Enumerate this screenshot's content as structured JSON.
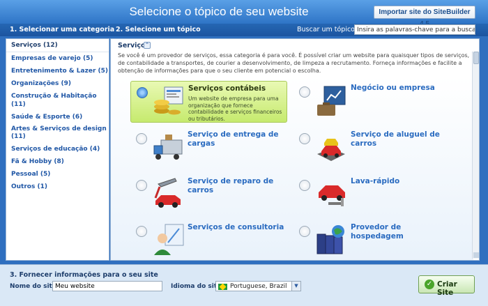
{
  "window": {
    "title": "Selecione o tópico de seu website",
    "import_button": "Importar site do SiteBuilder 4.5"
  },
  "steps": {
    "step1": "1. Selecionar uma categoria",
    "step2": "2. Selecione um tópico",
    "step3": "3. Fornecer informações para o seu site"
  },
  "search": {
    "label": "Buscar um tópico",
    "placeholder": "Insira as palavras-chave para a busca."
  },
  "categories": [
    {
      "label": "Serviços (12)",
      "selected": true
    },
    {
      "label": "Empresas de varejo (5)"
    },
    {
      "label": "Entretenimento & Lazer (5)"
    },
    {
      "label": "Organizações (9)"
    },
    {
      "label": "Construção & Habitação (11)"
    },
    {
      "label": "Saúde & Esporte (6)"
    },
    {
      "label": "Artes & Serviços de design (11)"
    },
    {
      "label": "Serviços de educação (4)"
    },
    {
      "label": "Fã & Hobby (8)"
    },
    {
      "label": "Pessoal (5)"
    },
    {
      "label": "Outros (1)"
    }
  ],
  "section": {
    "title": "Serviços",
    "description": "Se você é um provedor de serviços, essa categoria é para você. É possível criar um website para quaisquer tipos de serviços, de contabilidade a transportes, de courier a desenvolvimento, de limpeza a recrutamento. Forneça informações e facilite a obtenção de informações para que o seu cliente em potencial o escolha."
  },
  "topics": [
    {
      "label": "Serviços contábeis",
      "description": "Um website de empresa para uma organização que fornece contabilidade e serviços financeiros ou tributários.",
      "selected": true,
      "icon": "accounting-icon"
    },
    {
      "label": "Negócio ou empresa",
      "icon": "business-icon"
    },
    {
      "label": "Serviço de entrega de cargas",
      "icon": "delivery-truck-icon"
    },
    {
      "label": "Serviço de aluguel de carros",
      "icon": "car-rental-icon"
    },
    {
      "label": "Serviço de reparo de carros",
      "icon": "car-repair-icon"
    },
    {
      "label": "Lava-rápido",
      "icon": "car-wash-icon"
    },
    {
      "label": "Serviços de consultoria",
      "icon": "consulting-icon"
    },
    {
      "label": "Provedor de hospedagem",
      "icon": "hosting-icon"
    }
  ],
  "site_info": {
    "name_label": "Nome do site",
    "name_value": "Meu website",
    "language_label": "Idioma do site",
    "language_value": "Portuguese, Brazil"
  },
  "create_button": "Criar Site"
}
